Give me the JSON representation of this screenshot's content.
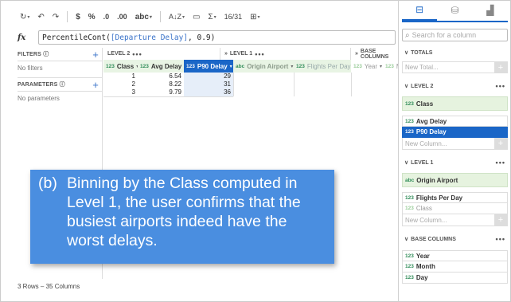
{
  "toolbar": {
    "currency": "$",
    "percent": "%",
    "dec_decrease": ".0",
    "dec_increase": ".00",
    "format": "abc",
    "sort": "A↓Z",
    "sum": "Σ",
    "special": "16/31"
  },
  "formula": {
    "label": "fx",
    "func": "PercentileCont(",
    "ref": "[Departure Delay]",
    "rest": ", 0.9)"
  },
  "left": {
    "filters_title": "FILTERS",
    "filters_note": "No filters",
    "params_title": "PARAMETERS",
    "params_note": "No parameters"
  },
  "grid": {
    "groups": [
      {
        "label": "LEVEL 2",
        "dots": "•••"
      },
      {
        "label": "LEVEL 1",
        "dots": "•••"
      },
      {
        "label": "BASE COLUMNS",
        "dots": ""
      }
    ],
    "headers": [
      {
        "type": "123",
        "name": "Class"
      },
      {
        "type": "123",
        "name": "Avg Delay"
      },
      {
        "type": "123",
        "name": "P90 Delay"
      },
      {
        "type": "abc",
        "name": "Origin Airport"
      },
      {
        "type": "123",
        "name": "Flights Per Day"
      },
      {
        "type": "123",
        "name": "Year"
      },
      {
        "type": "123",
        "name": "Mo"
      }
    ],
    "rows": [
      {
        "class": "1",
        "avg": "6.54",
        "p90": "29"
      },
      {
        "class": "2",
        "avg": "8.22",
        "p90": "31"
      },
      {
        "class": "3",
        "avg": "9.79",
        "p90": "36"
      }
    ]
  },
  "status": "3 Rows – 35 Columns",
  "caption": {
    "tag": "(b)",
    "lines": [
      "Binning by the Class computed in",
      "Level 1, the user confirms that the",
      "busiest airports indeed have the",
      "worst delays."
    ]
  },
  "right": {
    "search_placeholder": "Search for a column",
    "totals_title": "TOTALS",
    "new_total": "New Total...",
    "level2_title": "LEVEL 2",
    "level2_group": {
      "type": "123",
      "name": "Class"
    },
    "level2_items": [
      {
        "type": "123",
        "name": "Avg Delay"
      },
      {
        "type": "123",
        "name": "P90 Delay"
      }
    ],
    "new_column": "New Column...",
    "level1_title": "LEVEL 1",
    "level1_group": {
      "type": "abc",
      "name": "Origin Airport"
    },
    "level1_items": [
      {
        "type": "123",
        "name": "Flights Per Day"
      },
      {
        "type": "123",
        "name": "Class"
      }
    ],
    "base_title": "BASE COLUMNS",
    "base_items": [
      {
        "type": "123",
        "name": "Year"
      },
      {
        "type": "123",
        "name": "Month"
      },
      {
        "type": "123",
        "name": "Day"
      }
    ],
    "section_dots": "•••"
  },
  "colors": {
    "accent": "#1a66c7",
    "caption_bg": "#4a8ee0",
    "group_bg": "#e8f4e4"
  }
}
